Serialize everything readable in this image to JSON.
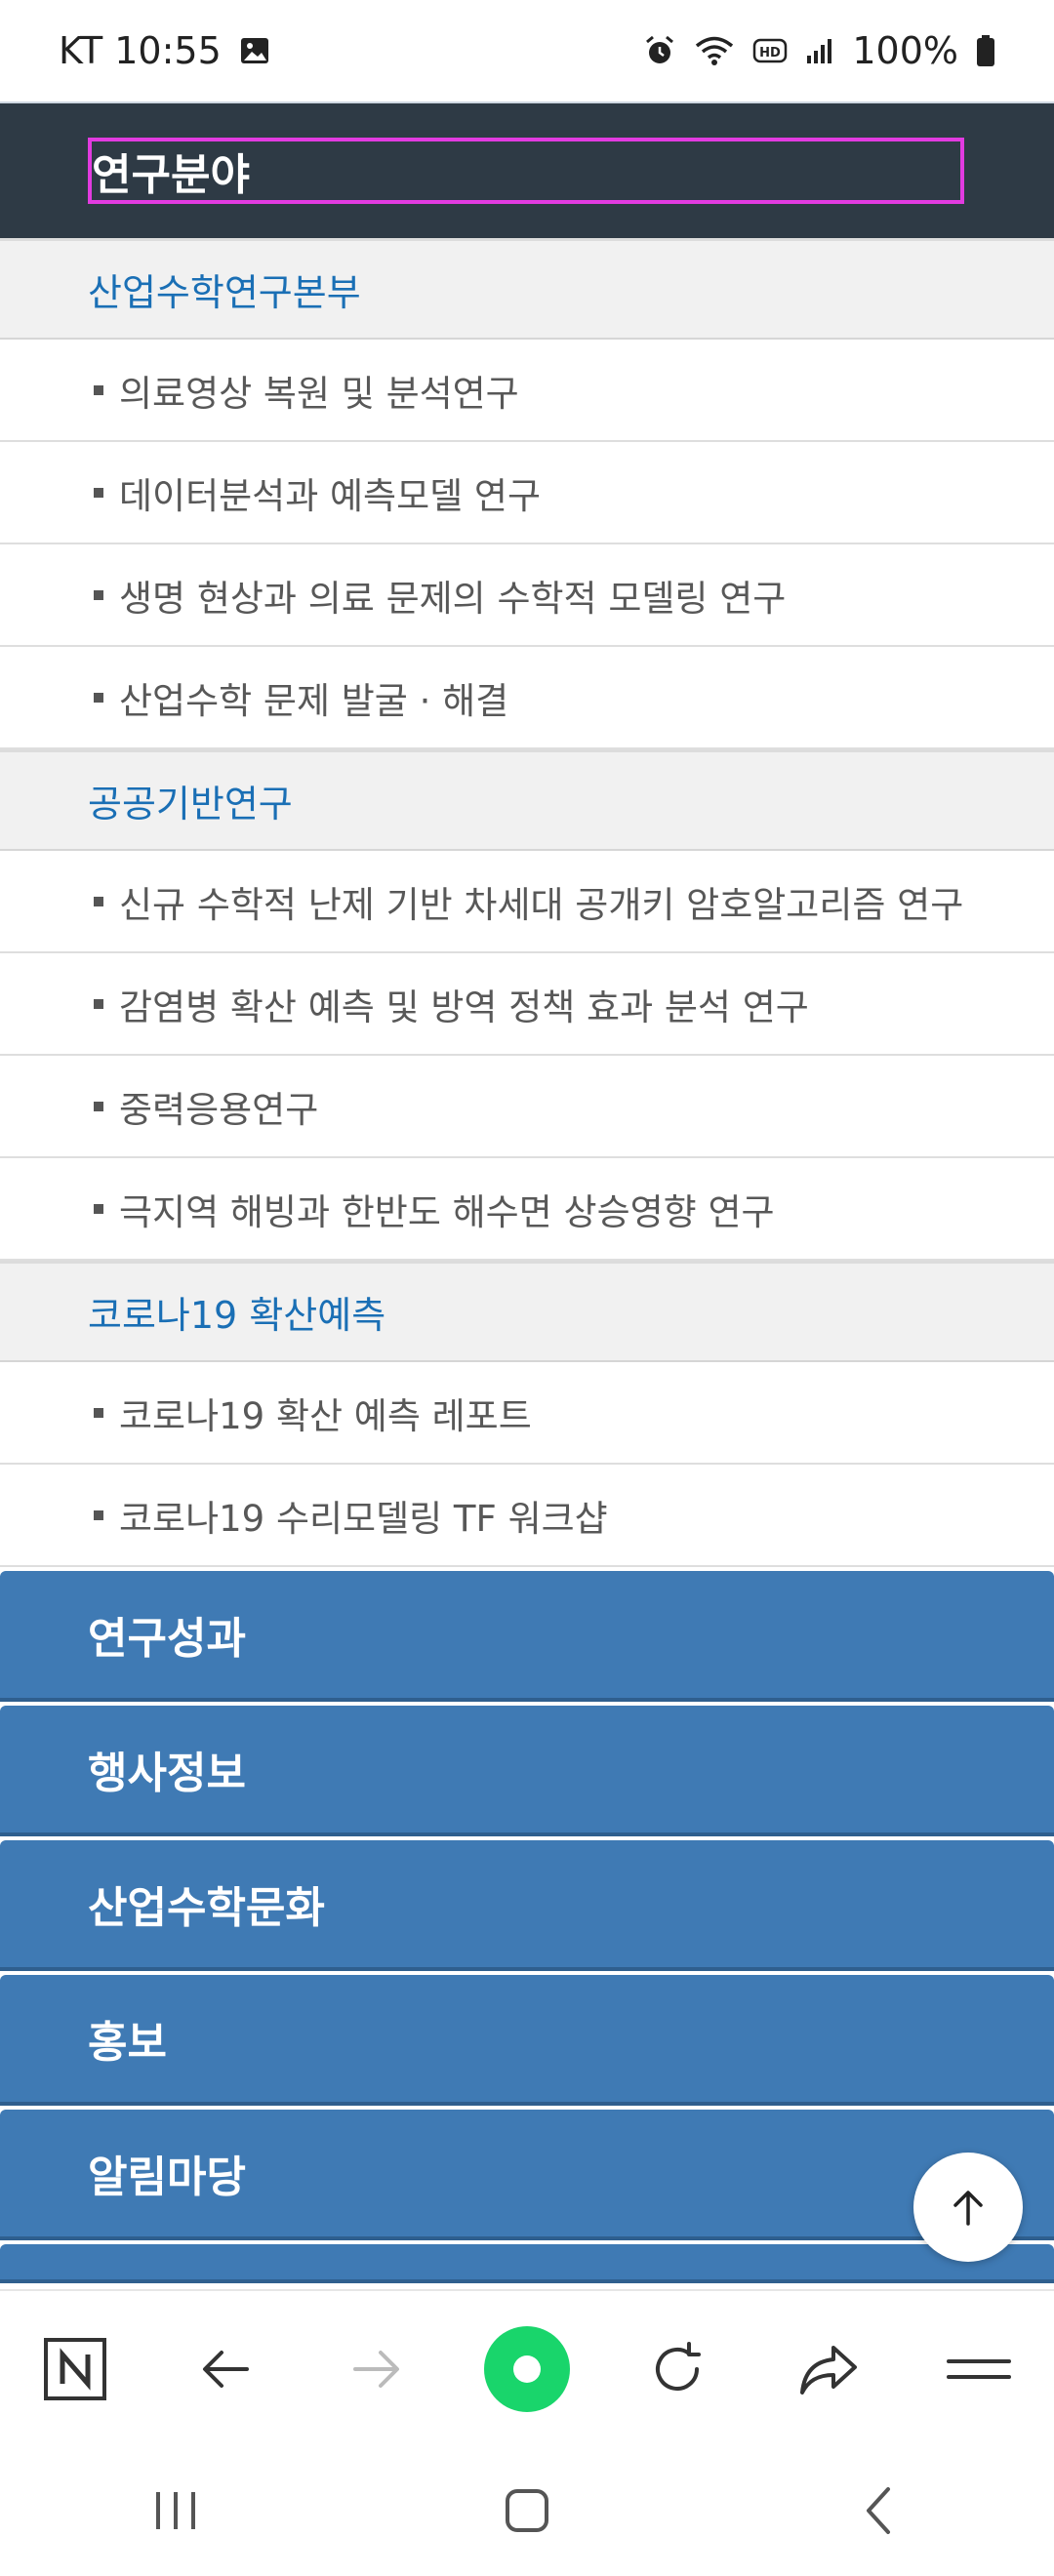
{
  "status": {
    "carrier_time": "KT 10:55",
    "battery": "100%"
  },
  "header": {
    "title": "연구분야"
  },
  "sections": [
    {
      "title": "산업수학연구본부",
      "items": [
        "의료영상 복원 및 분석연구",
        "데이터분석과 예측모델 연구",
        "생명 현상과 의료 문제의 수학적 모델링 연구",
        "산업수학 문제 발굴 · 해결"
      ]
    },
    {
      "title": "공공기반연구",
      "items": [
        "신규 수학적 난제 기반 차세대 공개키 암호알고리즘 연구",
        "감염병 확산 예측 및 방역 정책 효과 분석 연구",
        "중력응용연구",
        "극지역 해빙과 한반도 해수면 상승영향 연구"
      ]
    },
    {
      "title": "코로나19 확산예측",
      "items": [
        "코로나19 확산 예측 레포트",
        "코로나19 수리모델링 TF 워크샵"
      ]
    }
  ],
  "menus": [
    "연구성과",
    "행사정보",
    "산업수학문화",
    "홍보",
    "알림마당"
  ],
  "colors": {
    "dark_header": "#2e3a45",
    "highlight_border": "#e23be0",
    "section_text": "#1a6fb5",
    "menu_blue": "#3f7ab4"
  },
  "icons": {
    "browser": [
      "naver-n-icon",
      "back-arrow-icon",
      "forward-arrow-icon",
      "naver-green-icon",
      "refresh-icon",
      "share-icon",
      "menu-icon"
    ],
    "system": [
      "recents-icon",
      "home-icon",
      "back-icon"
    ]
  }
}
